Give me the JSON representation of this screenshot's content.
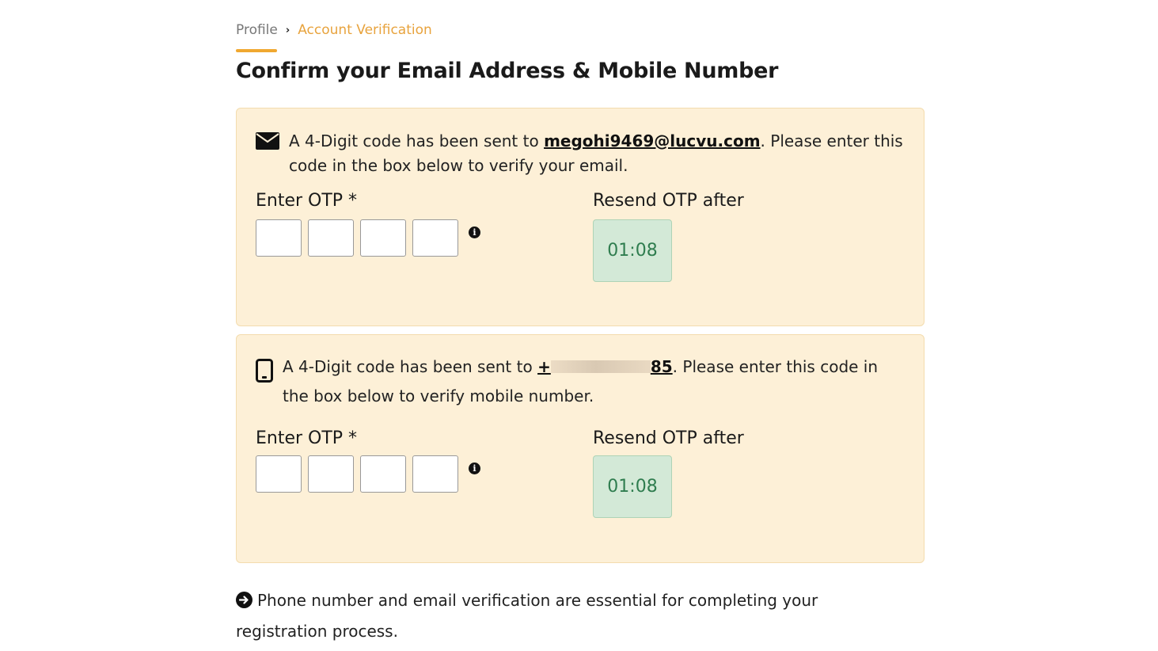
{
  "breadcrumb": {
    "profile": "Profile",
    "current": "Account Verification"
  },
  "page_title": "Confirm your Email Address & Mobile Number",
  "email_card": {
    "message_prefix": "A 4-Digit code has been sent to ",
    "contact": "megohi9469@lucvu.com",
    "message_suffix": ". Please enter this code in the box below to verify your email.",
    "otp_label": "Enter OTP *",
    "resend_label": "Resend OTP after",
    "timer": "01:08",
    "icon": "envelope-icon"
  },
  "phone_card": {
    "message_prefix": "A 4-Digit code has been sent to ",
    "contact_start": "+",
    "contact_end": "85",
    "message_suffix": ". Please enter this code in the box below to verify mobile number.",
    "otp_label": "Enter OTP *",
    "resend_label": "Resend OTP after",
    "timer": "01:08",
    "icon": "mobile-phone-icon"
  },
  "footer_note": "Phone number and email verification are essential for completing your registration process.",
  "colors": {
    "accent": "#f0a830",
    "card_bg": "#fdf0d7",
    "timer_bg": "#d3e9d7",
    "timer_text": "#2f7d4f"
  }
}
